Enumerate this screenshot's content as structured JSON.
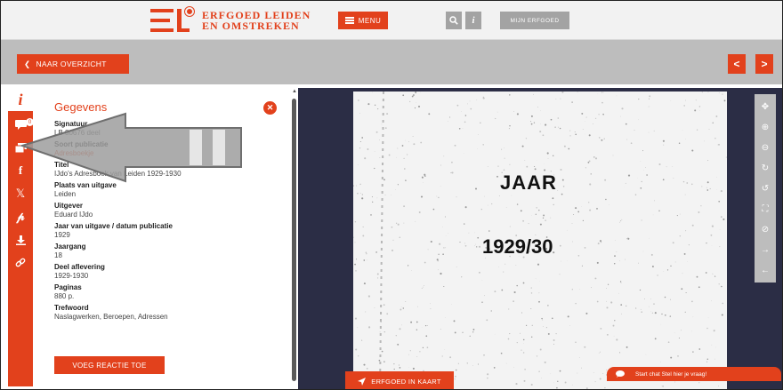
{
  "header": {
    "logo_line1": "ERFGOED LEIDEN",
    "logo_line2": "EN OMSTREKEN",
    "menu_label": "MENU",
    "search_icon": "search-icon",
    "info_icon": "info-icon",
    "mijn_label": "MIJN ERFGOED"
  },
  "toolbar": {
    "back_label": "NAAR OVERZICHT",
    "prev_symbol": "<",
    "next_symbol": ">"
  },
  "rail": {
    "info_symbol": "i",
    "badge": "0",
    "items": [
      "comment-icon",
      "copy-icon",
      "facebook-icon",
      "x-icon",
      "pinterest-icon",
      "download-icon",
      "link-icon"
    ]
  },
  "panel": {
    "title": "Gegevens",
    "fields": [
      {
        "label": "Signatuur",
        "value": "LB 80676 deel"
      },
      {
        "label": "Soort publicatie",
        "value": "Adresboekje"
      },
      {
        "label": "Titel",
        "value": "IJdo's Adresboek van Leiden 1929-1930"
      },
      {
        "label": "Plaats van uitgave",
        "value": "Leiden"
      },
      {
        "label": "Uitgever",
        "value": "Eduard IJdo"
      },
      {
        "label": "Jaar van uitgave / datum publicatie",
        "value": "1929"
      },
      {
        "label": "Jaargang",
        "value": "18"
      },
      {
        "label": "Deel aflevering",
        "value": "1929-1930"
      },
      {
        "label": "Paginas",
        "value": "880 p."
      },
      {
        "label": "Trefwoord",
        "value": "Naslagwerken, Beroepen, Adressen"
      }
    ],
    "button_label": "VOEG REACTIE TOE"
  },
  "viewer": {
    "scan_text_1": "JAAR",
    "scan_text_2": "1929/30",
    "tools": [
      "move-icon",
      "zoom-in-icon",
      "zoom-out-icon",
      "rotate-right-icon",
      "rotate-left-icon",
      "fullscreen-icon",
      "compass-icon",
      "next-page-icon",
      "prev-page-icon"
    ]
  },
  "footer": {
    "kaart_label": "ERFGOED IN KAART",
    "chat_label": "Start chat  Stel hier je vraag!"
  },
  "colors": {
    "accent": "#e2411c",
    "toolbar": "#bdbdbd",
    "viewer_bg": "#2b2d45"
  }
}
